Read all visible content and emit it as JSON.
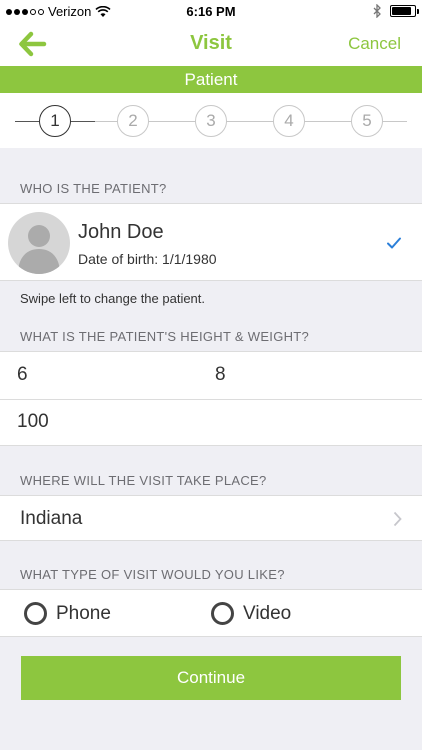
{
  "status_bar": {
    "carrier": "Verizon",
    "time": "6:16 PM",
    "battery_level": 0.85
  },
  "nav": {
    "title": "Visit",
    "cancel_label": "Cancel",
    "back_icon": "arrow-left-icon"
  },
  "section_title": "Patient",
  "stepper": {
    "steps": [
      "1",
      "2",
      "3",
      "4",
      "5"
    ],
    "active_step": 1
  },
  "patient": {
    "header": "WHO IS THE PATIENT?",
    "name": "John Doe",
    "dob": "Date of birth: 1/1/1980",
    "selected": true,
    "hint": "Swipe left to change the patient."
  },
  "height_weight": {
    "header": "WHAT IS THE PATIENT'S HEIGHT & WEIGHT?",
    "feet": "6",
    "inches": "8",
    "weight": "100"
  },
  "location": {
    "header": "WHERE WILL THE VISIT TAKE PLACE?",
    "value": "Indiana"
  },
  "visit_type": {
    "header": "WHAT TYPE OF VISIT WOULD YOU LIKE?",
    "options": [
      "Phone",
      "Video"
    ],
    "selected": null
  },
  "continue_label": "Continue",
  "colors": {
    "accent": "#8dc63f",
    "check": "#2b7fd9",
    "background": "#efeff4"
  }
}
